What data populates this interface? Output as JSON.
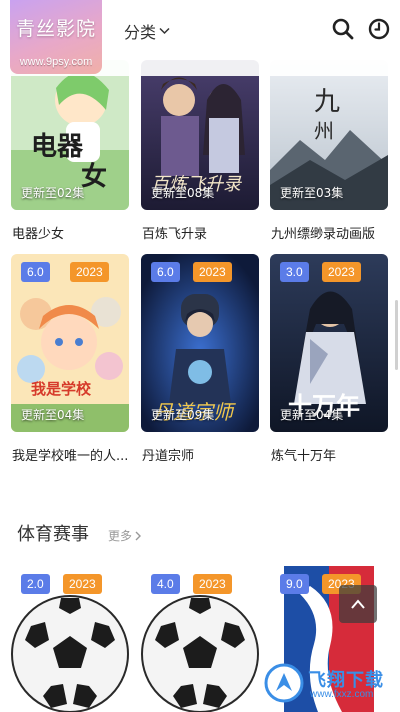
{
  "app": {
    "logo_name": "青丝影院",
    "logo_url": "www.9psy.com"
  },
  "header": {
    "category_label": "分类",
    "icons": [
      "search-icon",
      "history-clock-icon"
    ]
  },
  "grid": [
    {
      "title": "电器少女",
      "update": "更新至02集"
    },
    {
      "title": "百炼飞升录",
      "update": "更新至08集"
    },
    {
      "title": "九州缥缈录动画版",
      "update": "更新至03集"
    },
    {
      "title": "我是学校唯一的人...",
      "update": "更新至04集",
      "score": "6.0",
      "year": "2023"
    },
    {
      "title": "丹道宗师",
      "update": "更新至09集",
      "score": "6.0",
      "year": "2023"
    },
    {
      "title": "炼气十万年",
      "update": "更新至04集",
      "score": "3.0",
      "year": "2023"
    }
  ],
  "sports_section": {
    "title": "体育赛事",
    "more_label": "更多",
    "items": [
      {
        "score": "2.0",
        "year": "2023"
      },
      {
        "score": "4.0",
        "year": "2023"
      },
      {
        "score": "9.0",
        "year": "2023"
      }
    ]
  },
  "watermark": {
    "text": "飞翔下载",
    "url": "www.fxxz.com"
  },
  "colors": {
    "score_badge": "#5b7ce8",
    "year_badge": "#f4962a"
  }
}
